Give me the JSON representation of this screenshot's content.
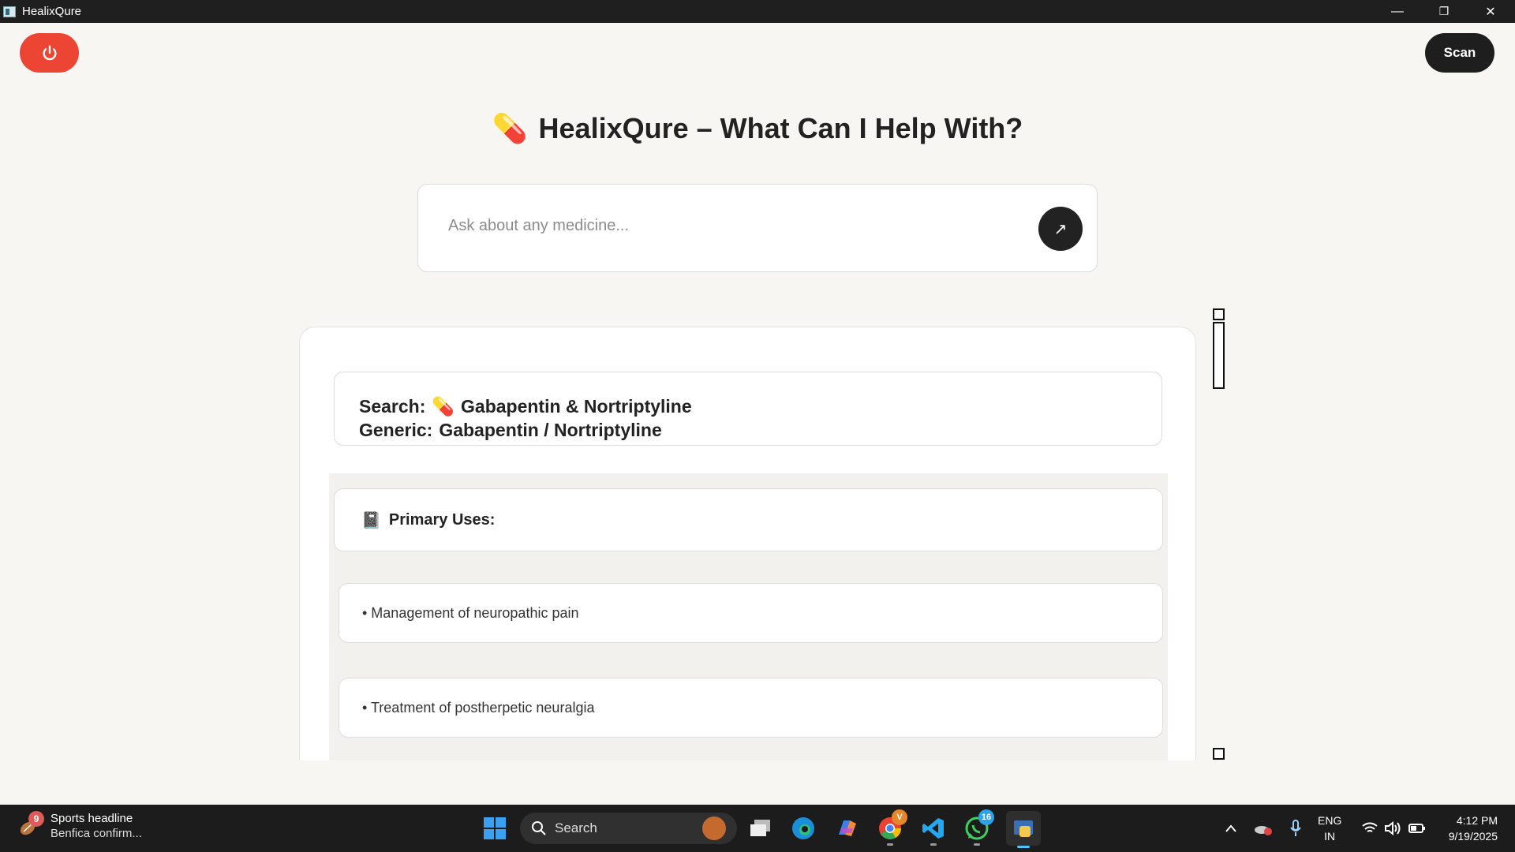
{
  "window": {
    "title": "HealixQure",
    "controls": {
      "minimize": "—",
      "restore": "❐",
      "close": "✕"
    }
  },
  "toolbar": {
    "power_icon": "power-icon",
    "scan_label": "Scan",
    "power_color": "#ec4534"
  },
  "header": {
    "icon": "💊",
    "title": "HealixQure – What Can I Help With?"
  },
  "search": {
    "placeholder": "Ask about any medicine...",
    "value": "",
    "send_icon": "↗"
  },
  "result": {
    "search_label": "Search:",
    "search_icon": "💊",
    "search_value": "Gabapentin & Nortriptyline",
    "generic_label": "Generic:",
    "generic_value": "Gabapentin / Nortriptyline",
    "uses_icon": "📓",
    "uses_title": "Primary Uses:",
    "uses": [
      "• Management of neuropathic pain",
      "• Treatment of postherpetic neuralgia"
    ]
  },
  "taskbar": {
    "news": {
      "badge": "9",
      "line1": "Sports headline",
      "line2": "Benfica confirm..."
    },
    "search_label": "Search",
    "chrome_badge": "V",
    "whatsapp_badge": "16",
    "lang_line1": "ENG",
    "lang_line2": "IN",
    "time": "4:12 PM",
    "date": "9/19/2025"
  }
}
